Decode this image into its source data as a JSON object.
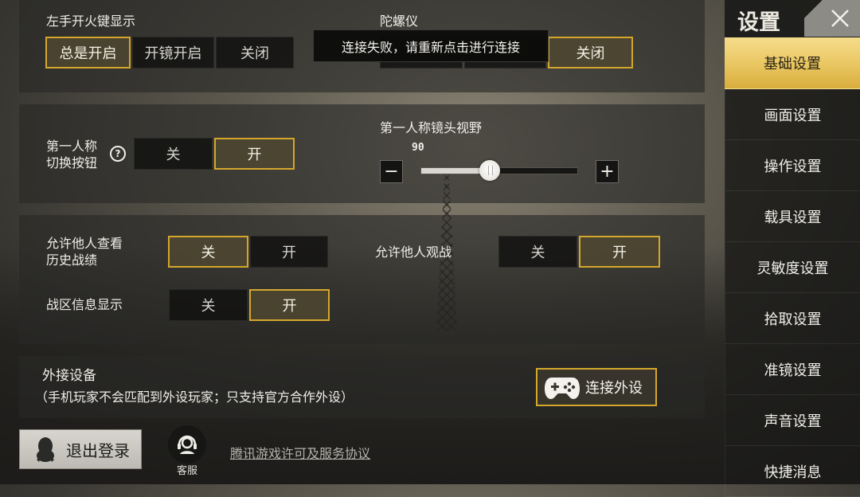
{
  "panel1": {
    "left_fire_label": "左手开火键显示",
    "left_fire_options": [
      "总是开启",
      "开镜开启",
      "关闭"
    ],
    "gyro_label": "陀螺仪",
    "gyro_off_label": "关闭",
    "toast": "连接失败，请重新点击进行连接"
  },
  "panel2": {
    "fp_switch_label_line1": "第一人称",
    "fp_switch_label_line2": "切换按钮",
    "help_glyph": "?",
    "fp_switch_options": [
      "关",
      "开"
    ],
    "fov_label": "第一人称镜头视野",
    "fov_value": "90",
    "fov_fraction": 0.44,
    "minus": "−",
    "plus": "+"
  },
  "panel3": {
    "history_label_line1": "允许他人查看",
    "history_label_line2": "历史战绩",
    "history_options": [
      "关",
      "开"
    ],
    "spectate_label": "允许他人观战",
    "spectate_options": [
      "关",
      "开"
    ],
    "zone_label": "战区信息显示",
    "zone_options": [
      "关",
      "开"
    ]
  },
  "panel4": {
    "device_title": "外接设备",
    "device_note": "（手机玩家不会匹配到外设玩家；只支持官方合作外设）",
    "connect_label": "连接外设",
    "connect_icon": "gamepad-icon"
  },
  "footer": {
    "logout_label": "退出登录",
    "logout_icon": "qq-penguin-icon",
    "service_label": "客服",
    "service_icon": "headset-icon",
    "license_link": "腾讯游戏许可及服务协议"
  },
  "sidebar": {
    "title": "设置",
    "close_icon": "close-icon",
    "items": [
      {
        "label": "基础设置"
      },
      {
        "label": "画面设置"
      },
      {
        "label": "操作设置"
      },
      {
        "label": "载具设置"
      },
      {
        "label": "灵敏度设置"
      },
      {
        "label": "拾取设置"
      },
      {
        "label": "准镜设置"
      },
      {
        "label": "声音设置"
      },
      {
        "label": "快捷消息"
      }
    ]
  },
  "colors": {
    "accent_gold": "#d4a72c",
    "active_tab": "#e7c35c"
  }
}
